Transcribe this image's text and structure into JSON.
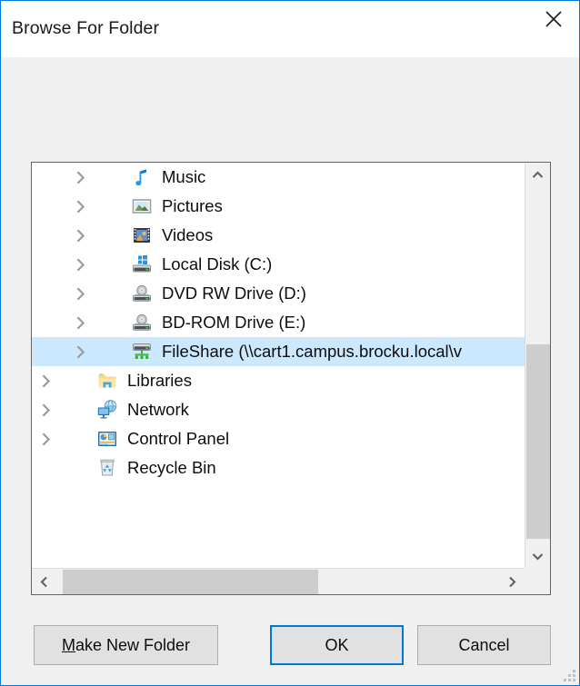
{
  "window": {
    "title": "Browse For Folder",
    "close_icon": "close-icon",
    "accent_color": "#0078d7",
    "body_color": "#f0f0f0",
    "selection_color": "#cce8ff"
  },
  "tree": {
    "items": [
      {
        "label": "Music",
        "icon": "music-note-icon",
        "level": 1,
        "expandable": true,
        "selected": false
      },
      {
        "label": "Pictures",
        "icon": "pictures-icon",
        "level": 1,
        "expandable": true,
        "selected": false
      },
      {
        "label": "Videos",
        "icon": "videos-icon",
        "level": 1,
        "expandable": true,
        "selected": false
      },
      {
        "label": "Local Disk (C:)",
        "icon": "hard-drive-icon",
        "level": 1,
        "expandable": true,
        "selected": false
      },
      {
        "label": "DVD RW Drive (D:)",
        "icon": "optical-drive-icon",
        "level": 1,
        "expandable": true,
        "selected": false
      },
      {
        "label": "BD-ROM Drive (E:)",
        "icon": "optical-drive-icon",
        "level": 1,
        "expandable": true,
        "selected": false
      },
      {
        "label": "FileShare (\\\\cart1.campus.brocku.local\\v",
        "icon": "network-drive-icon",
        "level": 1,
        "expandable": true,
        "selected": true
      },
      {
        "label": "Libraries",
        "icon": "libraries-icon",
        "level": 0,
        "expandable": true,
        "selected": false
      },
      {
        "label": "Network",
        "icon": "network-icon",
        "level": 0,
        "expandable": true,
        "selected": false
      },
      {
        "label": "Control Panel",
        "icon": "control-panel-icon",
        "level": 0,
        "expandable": true,
        "selected": false
      },
      {
        "label": "Recycle Bin",
        "icon": "recycle-bin-icon",
        "level": 0,
        "expandable": false,
        "selected": false
      }
    ],
    "vertical_scrollbar": {
      "up_arrow_icon": "chevron-up-icon",
      "down_arrow_icon": "chevron-down-icon"
    },
    "horizontal_scrollbar": {
      "left_arrow_icon": "chevron-left-icon",
      "right_arrow_icon": "chevron-right-icon"
    }
  },
  "buttons": {
    "make_new_folder": "Make New Folder",
    "make_new_folder_accel": "M",
    "make_new_folder_rest": "ake New Folder",
    "ok": "OK",
    "cancel": "Cancel"
  }
}
